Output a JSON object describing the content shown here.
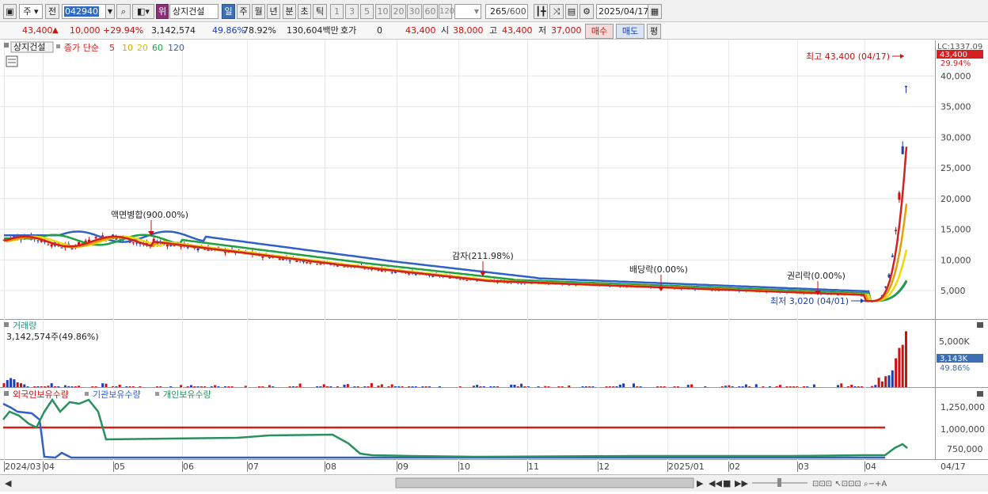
{
  "toolbar": {
    "market": "주",
    "prev": "전",
    "code": "042940",
    "warn_badge": "위",
    "stock_name": "상지건설",
    "periods": [
      "일",
      "주",
      "월",
      "년",
      "분",
      "초",
      "틱"
    ],
    "nums": [
      "1",
      "3",
      "5",
      "10",
      "20",
      "30",
      "60",
      "120"
    ],
    "count": "265",
    "count_max": "/600",
    "date": "2025/04/17"
  },
  "quote": {
    "price": "43,400",
    "change": "10,000",
    "change_pct": "+29.94%",
    "volume": "3,142,574",
    "vol_pct": "49.86%",
    "rate2": "78.92%",
    "amount": "130,604백만",
    "hoga_label": "호가",
    "hoga_val": "0",
    "hoga_price": "43,400",
    "open_label": "시",
    "open": "38,000",
    "high_label": "고",
    "high": "43,400",
    "low_label": "저",
    "low": "37,000",
    "buy": "매수",
    "sell": "매도",
    "avg": "평"
  },
  "legend": {
    "name": "상지건설",
    "close_label": "종가 단순",
    "ma": [
      "5",
      "10",
      "20",
      "60",
      "120"
    ],
    "ma_colors": [
      "#d42020",
      "#e8a000",
      "#f0d800",
      "#20a040",
      "#3060c8"
    ]
  },
  "price_axis": {
    "top_label": "LC:1337.09",
    "current": "43,400",
    "current_pct": "29.94%",
    "ticks": [
      "40,000",
      "35,000",
      "30,000",
      "25,000",
      "20,000",
      "15,000",
      "10,000",
      "5,000"
    ]
  },
  "annotations": {
    "high": "최고 43,400 (04/17)",
    "low": "최저 3,020 (04/01)",
    "split": "액면병합(900.00%)",
    "reduction": "감자(211.98%)",
    "dividend": "배당락(0.00%)",
    "rights": "권리락(0.00%)"
  },
  "volume_panel": {
    "title": "거래량",
    "value": "3,142,574주(49.86%)",
    "tick": "5,000K",
    "current": "3,143K",
    "current_pct": "49.86%"
  },
  "holding_panel": {
    "foreign": "외국인보유수량",
    "institution": "기관보유수량",
    "individual": "개인보유수량",
    "ticks": [
      "1,250,000",
      "1,000,000",
      "750,000"
    ]
  },
  "x_axis": {
    "labels": [
      "2024/03",
      "04",
      "05",
      "06",
      "07",
      "08",
      "09",
      "10",
      "11",
      "12",
      "2025/01",
      "02",
      "03",
      "04"
    ],
    "right": "04/17"
  },
  "colors": {
    "ma5": "#d42020",
    "ma10": "#e8a000",
    "ma20": "#f0d800",
    "ma60": "#20a040",
    "ma120": "#3060c8",
    "up": "#d01010",
    "down": "#1a3fb0"
  }
}
